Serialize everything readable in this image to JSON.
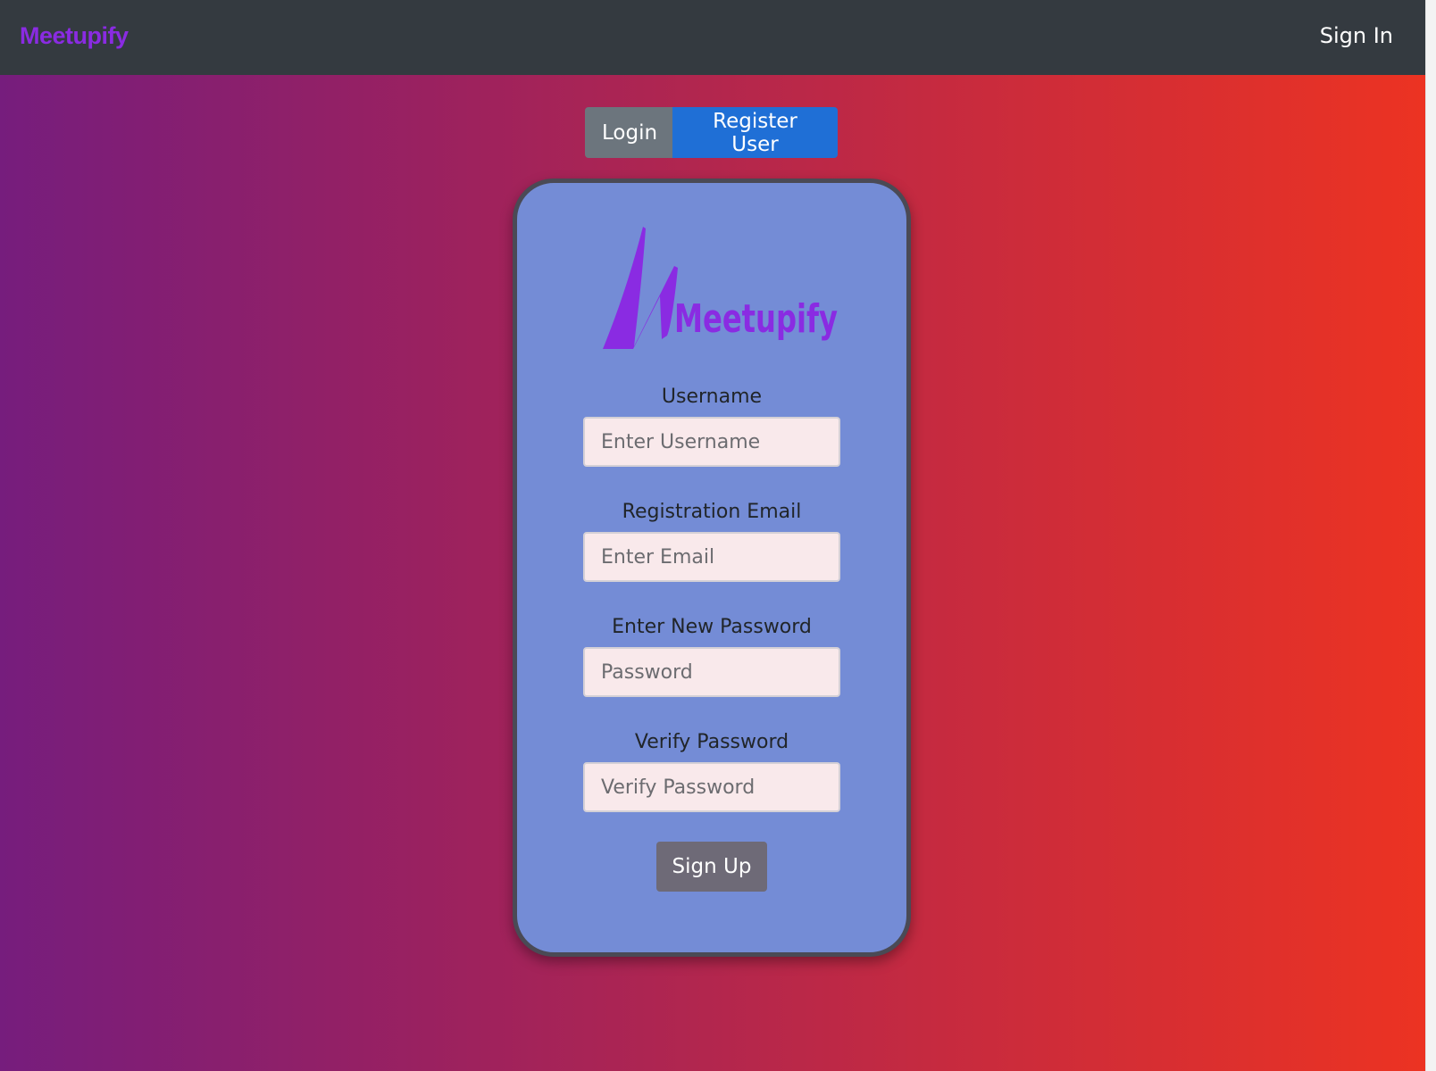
{
  "navbar": {
    "brand": "Meetupify",
    "sign_in": "Sign In",
    "brand_color": "#8a2be2",
    "background_color": "#343a40"
  },
  "auth_toggle": {
    "login_label": "Login",
    "register_label": "Register User",
    "active": "register"
  },
  "card": {
    "logo_text": "Meetupify",
    "logo_color": "#8a2be2",
    "fields": [
      {
        "label": "Username",
        "placeholder": "Enter Username",
        "value": ""
      },
      {
        "label": "Registration Email",
        "placeholder": "Enter Email",
        "value": ""
      },
      {
        "label": "Enter New Password",
        "placeholder": "Password",
        "value": ""
      },
      {
        "label": "Verify Password",
        "placeholder": "Verify Password",
        "value": ""
      }
    ],
    "submit_label": "Sign Up"
  },
  "colors": {
    "gradient_start": "#761d7d",
    "gradient_end": "#ec3322",
    "card_background": "#748cd6",
    "register_active": "#1f6fd6",
    "login_inactive": "#6c757d"
  }
}
